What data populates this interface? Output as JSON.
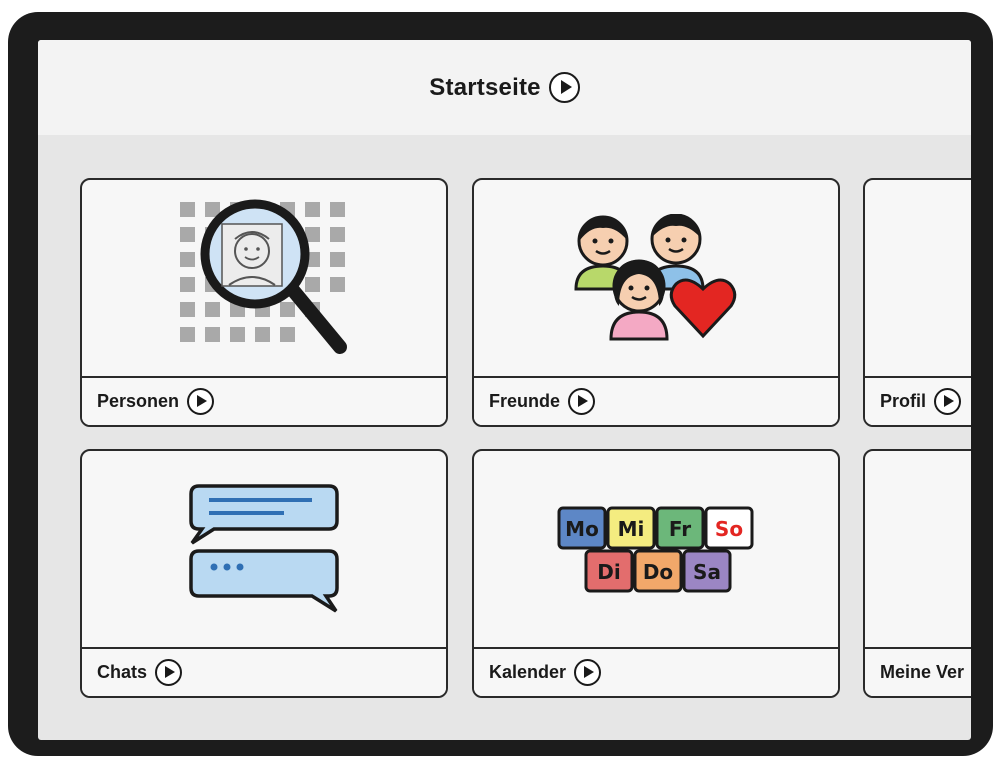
{
  "header": {
    "title": "Startseite",
    "play_icon": "play-icon"
  },
  "tiles": [
    {
      "label": "Personen",
      "icon": "person-search-icon"
    },
    {
      "label": "Freunde",
      "icon": "friends-icon"
    },
    {
      "label": "Profil",
      "icon": "profile-icon"
    },
    {
      "label": "Chats",
      "icon": "chat-bubbles-icon"
    },
    {
      "label": "Kalender",
      "icon": "calendar-days-icon"
    },
    {
      "label": "Meine Ver",
      "icon": "unknown-icon"
    }
  ],
  "calendar": {
    "days_top": [
      "Mo",
      "Mi",
      "Fr",
      "So"
    ],
    "days_bottom": [
      "Di",
      "Do",
      "Sa"
    ]
  },
  "colors": {
    "tile_bg": "#f7f7f7",
    "screen_bg": "#e6e6e6",
    "bezel": "#1c1c1c",
    "heart": "#e32622",
    "bubble_fill": "#b9d9f2",
    "bubble_text": "#2f6fb4"
  }
}
